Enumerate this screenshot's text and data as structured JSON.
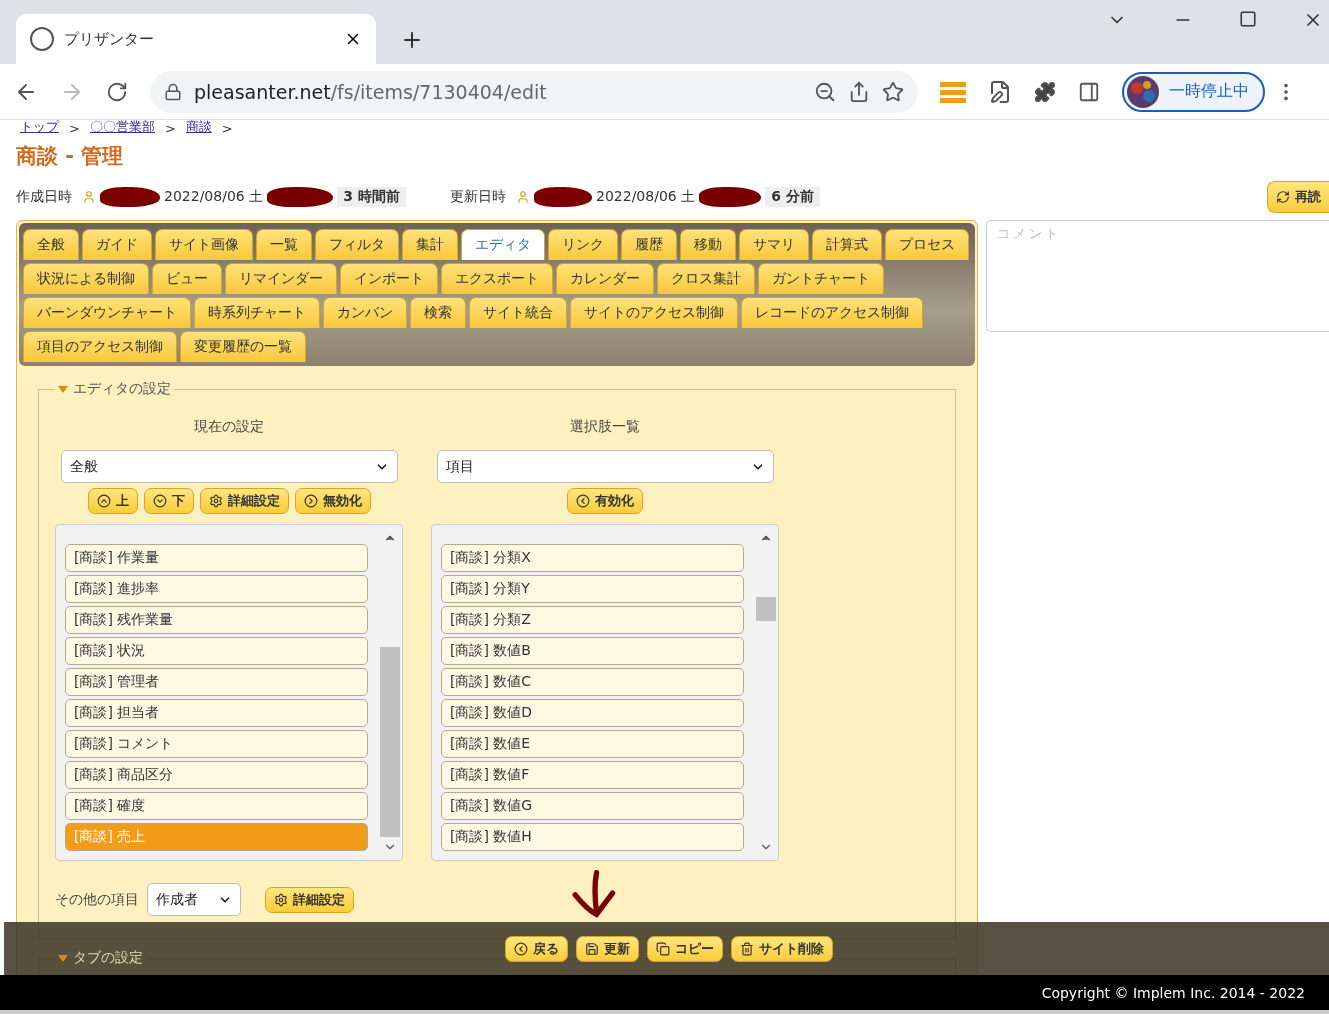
{
  "browser": {
    "tab_title": "プリザンター",
    "url_host": "pleasanter.net",
    "url_path": "/fs/items/7130404/edit",
    "profile_status": "一時停止中"
  },
  "breadcrumbs": [
    {
      "label": "トップ"
    },
    {
      "label": "〇〇営業部"
    },
    {
      "label": "商談"
    }
  ],
  "breadcrumb_separator": ">",
  "title": "商談 - 管理",
  "meta": [
    {
      "label": "作成日時",
      "date": "2022/08/06 土",
      "ago": "3 時間前"
    },
    {
      "label": "更新日時",
      "date": "2022/08/06 土",
      "ago": "6 分前"
    }
  ],
  "reload_button": {
    "label": "再読",
    "kind": "reload"
  },
  "tabs": [
    {
      "label": "全般",
      "selected": false
    },
    {
      "label": "ガイド",
      "selected": false
    },
    {
      "label": "サイト画像",
      "selected": false
    },
    {
      "label": "一覧",
      "selected": false
    },
    {
      "label": "フィルタ",
      "selected": false
    },
    {
      "label": "集計",
      "selected": false
    },
    {
      "label": "エディタ",
      "selected": true
    },
    {
      "label": "リンク",
      "selected": false
    },
    {
      "label": "履歴",
      "selected": false
    },
    {
      "label": "移動",
      "selected": false
    },
    {
      "label": "サマリ",
      "selected": false
    },
    {
      "label": "計算式",
      "selected": false
    },
    {
      "label": "プロセス",
      "selected": false
    },
    {
      "label": "状況による制御",
      "selected": false
    },
    {
      "label": "ビュー",
      "selected": false
    },
    {
      "label": "リマインダー",
      "selected": false
    },
    {
      "label": "インポート",
      "selected": false
    },
    {
      "label": "エクスポート",
      "selected": false
    },
    {
      "label": "カレンダー",
      "selected": false
    },
    {
      "label": "クロス集計",
      "selected": false
    },
    {
      "label": "ガントチャート",
      "selected": false
    },
    {
      "label": "バーンダウンチャート",
      "selected": false
    },
    {
      "label": "時系列チャート",
      "selected": false
    },
    {
      "label": "カンバン",
      "selected": false
    },
    {
      "label": "検索",
      "selected": false
    },
    {
      "label": "サイト統合",
      "selected": false
    },
    {
      "label": "サイトのアクセス制御",
      "selected": false
    },
    {
      "label": "レコードのアクセス制御",
      "selected": false
    },
    {
      "label": "項目のアクセス制御",
      "selected": false
    },
    {
      "label": "変更履歴の一覧",
      "selected": false
    }
  ],
  "editor_section": {
    "legend": "エディタの設定",
    "expanded": true,
    "columns": [
      {
        "heading": "現在の設定",
        "select": "全般",
        "buttons": [
          {
            "label": "上",
            "kind": "up"
          },
          {
            "label": "下",
            "kind": "down"
          },
          {
            "label": "詳細設定",
            "kind": "settings"
          },
          {
            "label": "無効化",
            "kind": "disable"
          }
        ],
        "items": [
          {
            "label": "[商談] 作業量",
            "selected": false
          },
          {
            "label": "[商談] 進捗率",
            "selected": false
          },
          {
            "label": "[商談] 残作業量",
            "selected": false
          },
          {
            "label": "[商談] 状況",
            "selected": false
          },
          {
            "label": "[商談] 管理者",
            "selected": false
          },
          {
            "label": "[商談] 担当者",
            "selected": false
          },
          {
            "label": "[商談] コメント",
            "selected": false
          },
          {
            "label": "[商談] 商品区分",
            "selected": false
          },
          {
            "label": "[商談] 確度",
            "selected": false
          },
          {
            "label": "[商談] 売上",
            "selected": true
          }
        ]
      },
      {
        "heading": "選択肢一覧",
        "select": "項目",
        "buttons": [
          {
            "label": "有効化",
            "kind": "enable"
          }
        ],
        "items": [
          {
            "label": "[商談] 分類X",
            "selected": false
          },
          {
            "label": "[商談] 分類Y",
            "selected": false
          },
          {
            "label": "[商談] 分類Z",
            "selected": false
          },
          {
            "label": "[商談] 数値B",
            "selected": false
          },
          {
            "label": "[商談] 数値C",
            "selected": false
          },
          {
            "label": "[商談] 数値D",
            "selected": false
          },
          {
            "label": "[商談] 数値E",
            "selected": false
          },
          {
            "label": "[商談] 数値F",
            "selected": false
          },
          {
            "label": "[商談] 数値G",
            "selected": false
          },
          {
            "label": "[商談] 数値H",
            "selected": false
          }
        ]
      }
    ],
    "other": {
      "label": "その他の項目",
      "select": "作成者",
      "button": {
        "label": "詳細設定",
        "kind": "settings"
      }
    }
  },
  "tab_section": {
    "legend": "タブの設定",
    "expanded": true
  },
  "actions": [
    {
      "label": "戻る",
      "kind": "back"
    },
    {
      "label": "更新",
      "kind": "save"
    },
    {
      "label": "コピー",
      "kind": "copy"
    },
    {
      "label": "サイト削除",
      "kind": "delete"
    }
  ],
  "comment": {
    "placeholder": "コメント"
  },
  "footer": "Copyright © Implem Inc. 2014 - 2022"
}
